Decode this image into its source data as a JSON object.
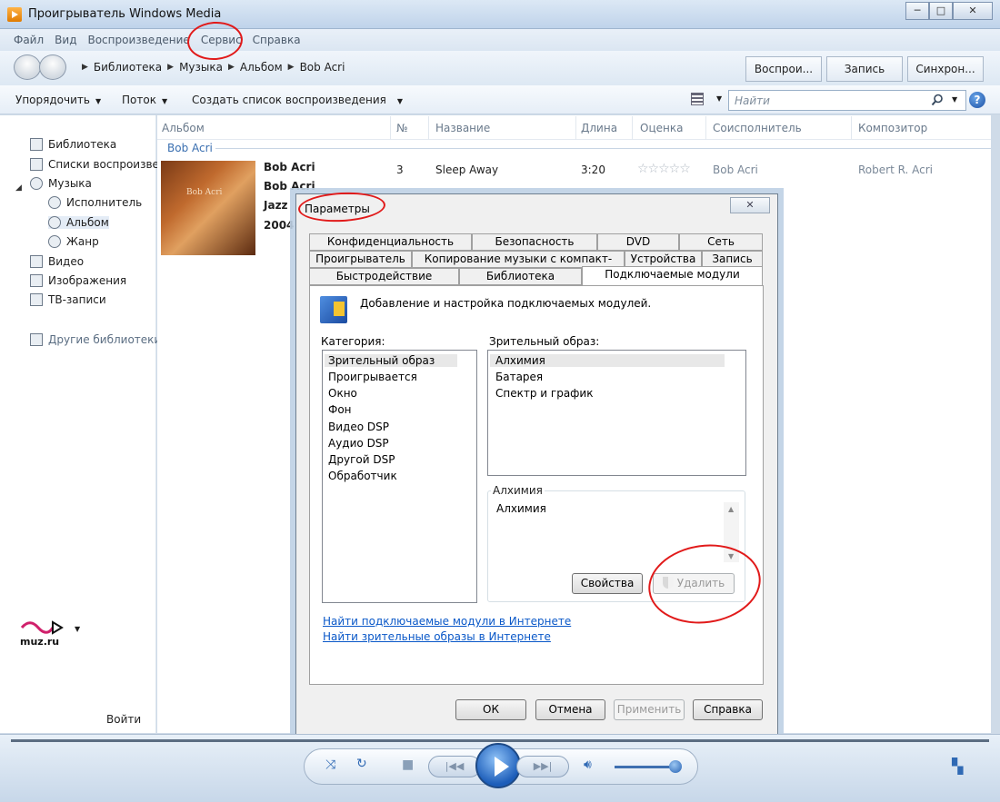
{
  "window": {
    "title": "Проигрыватель Windows Media",
    "buttons": [
      "─",
      "□",
      "✕"
    ]
  },
  "menu": [
    "Файл",
    "Вид",
    "Воспроизведение",
    "Сервис",
    "Справка"
  ],
  "breadcrumb": [
    "Библиотека",
    "Музыка",
    "Альбом",
    "Bob Acri"
  ],
  "top_tabs": [
    "Воспрои...",
    "Запись",
    "Синхрон..."
  ],
  "toolbar": {
    "organize": "Упорядочить",
    "stream": "Поток",
    "create_playlist": "Создать список воспроизведения"
  },
  "search": {
    "placeholder": "Найти"
  },
  "nav": {
    "library": "Библиотека",
    "playlists": "Списки воспроизве",
    "music": "Музыка",
    "artist": "Исполнитель",
    "album": "Альбом",
    "genre": "Жанр",
    "video": "Видео",
    "pictures": "Изображения",
    "tv": "ТВ-записи",
    "other_libraries": "Другие библиотеки",
    "brand": "muz.ru",
    "sign_in": "Войти"
  },
  "columns": [
    "Альбом",
    "№",
    "Название",
    "Длина",
    "Оценка",
    "Соисполнитель",
    "Композитор"
  ],
  "group_label": "Bob Acri",
  "album": {
    "artist": "Bob Acri",
    "title": "Bob Acri",
    "genre": "Jazz",
    "year": "2004"
  },
  "track": {
    "number": "3",
    "title": "Sleep Away",
    "length": "3:20",
    "rating": "☆☆☆☆☆",
    "contributing_artist": "Bob Acri",
    "composer": "Robert R. Acri"
  },
  "dialog": {
    "title": "Параметры",
    "close": "✕",
    "tabs_row1": [
      "Конфиденциальность",
      "Безопасность",
      "DVD",
      "Сеть"
    ],
    "tabs_row2": [
      "Проигрыватель",
      "Копирование музыки с компакт-диска",
      "Устройства",
      "Запись"
    ],
    "tabs_row3": [
      "Быстродействие",
      "Библиотека",
      "Подключаемые модули"
    ],
    "description": "Добавление и настройка подключаемых модулей.",
    "category_label": "Категория:",
    "categories": [
      "Зрительный образ",
      "Проигрывается",
      "Окно",
      "Фон",
      "Видео DSP",
      "Аудио DSP",
      "Другой DSP",
      "Обработчик"
    ],
    "visual_label": "Зрительный образ:",
    "visuals": [
      "Алхимия",
      "Батарея",
      "Спектр и график"
    ],
    "details_group": "Алхимия",
    "details_text": "Алхимия",
    "properties_btn": "Свойства",
    "remove_btn": "Удалить",
    "link1": "Найти подключаемые модули в Интернете",
    "link2": "Найти зрительные образы в Интернете",
    "ok": "ОК",
    "cancel": "Отмена",
    "apply": "Применить",
    "help": "Справка"
  },
  "colors": {
    "annotation": "#e11a1a",
    "link": "#0a58c8",
    "accent": "#1c5db9"
  }
}
